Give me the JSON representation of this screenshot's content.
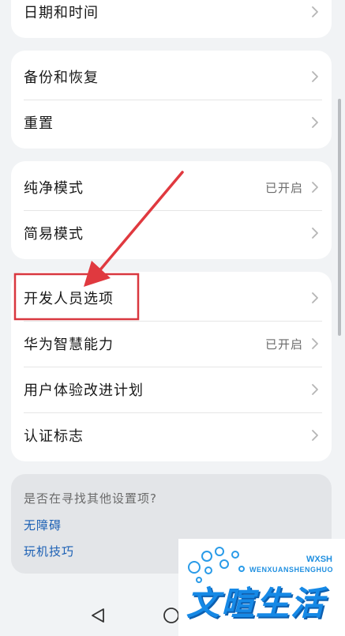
{
  "groups": [
    {
      "items": [
        {
          "label": "日期和时间"
        }
      ]
    },
    {
      "items": [
        {
          "label": "备份和恢复"
        },
        {
          "label": "重置"
        }
      ]
    },
    {
      "items": [
        {
          "label": "纯净模式",
          "value": "已开启"
        },
        {
          "label": "简易模式"
        }
      ]
    },
    {
      "items": [
        {
          "label": "开发人员选项",
          "highlighted": true
        },
        {
          "label": "华为智慧能力",
          "value": "已开启"
        },
        {
          "label": "用户体验改进计划"
        },
        {
          "label": "认证标志"
        }
      ]
    }
  ],
  "help": {
    "question": "是否在寻找其他设置项?",
    "links": [
      "无障碍",
      "玩机技巧"
    ]
  },
  "annotation": {
    "highlight_color": "#d9373f",
    "arrow_color": "#e0393f"
  },
  "watermark": {
    "title": "文暄生活",
    "subtitle": "WENXUANSHENGHUO",
    "brand": "WXSH"
  },
  "nav": {
    "buttons": [
      "back",
      "home"
    ]
  },
  "colors": {
    "background": "#f1f3f5",
    "card": "#ffffff",
    "link": "#1a5fb4",
    "secondary_text": "#6b6b6b"
  }
}
